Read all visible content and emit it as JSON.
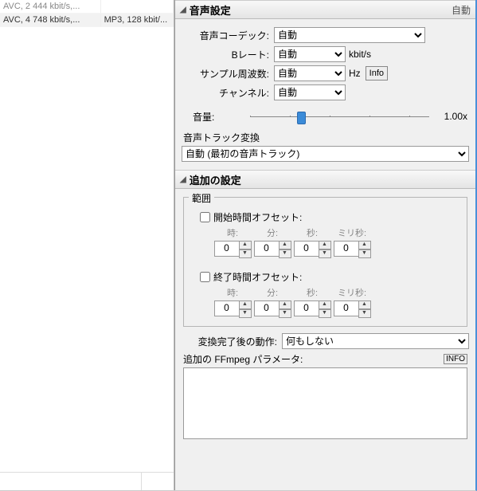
{
  "left": {
    "rows": [
      {
        "c1": "AVC, 2 444 kbit/s,...",
        "c2": ""
      },
      {
        "c1": "AVC, 4 748 kbit/s,...",
        "c2": "MP3, 128 kbit/..."
      }
    ]
  },
  "audio": {
    "header": "音声設定",
    "auto_label": "自動",
    "codec_label": "音声コーデック:",
    "codec_value": "自動",
    "bitrate_label": "Bレート:",
    "bitrate_value": "自動",
    "bitrate_unit": "kbit/s",
    "sample_label": "サンプル周波数:",
    "sample_value": "自動",
    "sample_unit": "Hz",
    "sample_info": "Info",
    "channel_label": "チャンネル:",
    "channel_value": "自動",
    "volume_label": "音量:",
    "volume_value": "1.00x",
    "track_label": "音声トラック変換",
    "track_value": "自動 (最初の音声トラック)"
  },
  "extra": {
    "header": "追加の設定",
    "range_title": "範囲",
    "start_label": "開始時間オフセット:",
    "end_label": "終了時間オフセット:",
    "h": "時:",
    "m": "分:",
    "s": "秒:",
    "ms": "ミリ秒:",
    "zero": "0",
    "after_label": "変換完了後の動作:",
    "after_value": "何もしない",
    "ff_label": "追加の FFmpeg パラメータ:",
    "ff_info": "INFO",
    "ff_value": ""
  }
}
